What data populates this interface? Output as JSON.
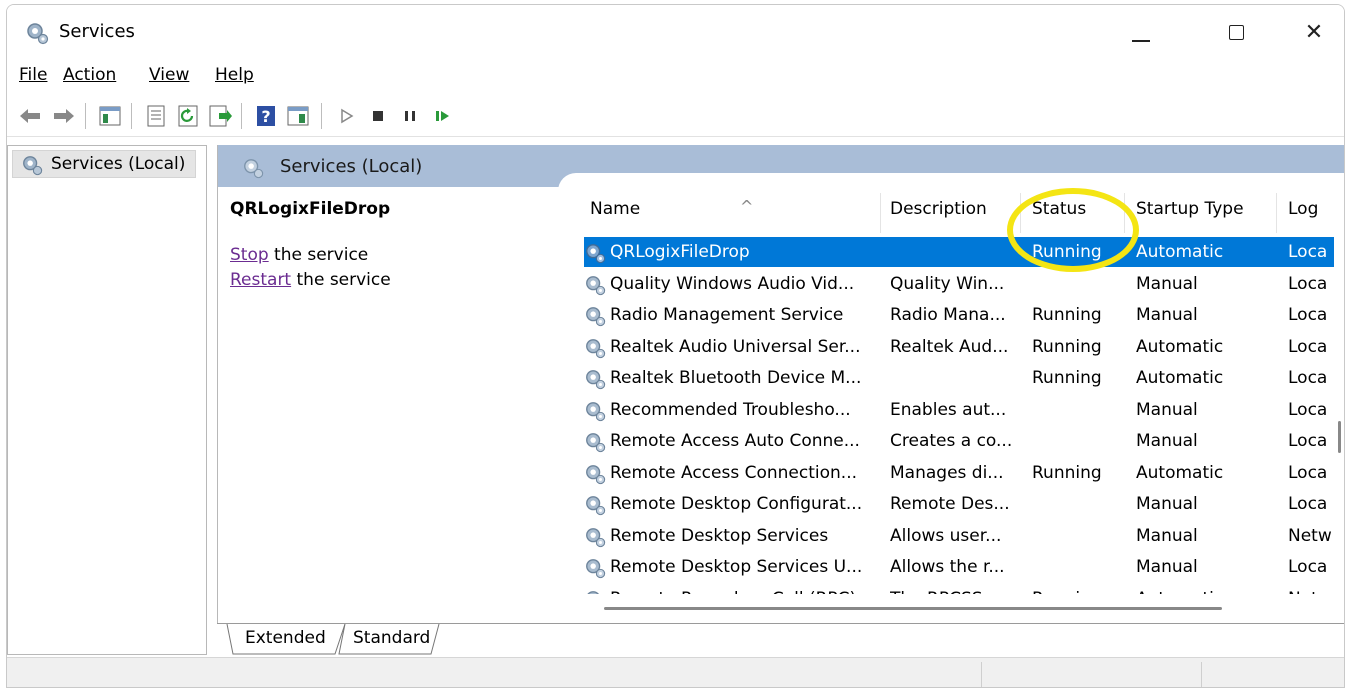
{
  "window": {
    "title": "Services",
    "minimize_glyph": "—",
    "close_glyph": "✕"
  },
  "menu": {
    "file": "File",
    "action": "Action",
    "view": "View",
    "help": "Help"
  },
  "toolbar": {
    "icons": [
      "back-icon",
      "forward-icon",
      "show-hide-tree-icon",
      "properties-icon",
      "refresh-icon",
      "export-list-icon",
      "help-icon",
      "extended-view-icon",
      "start-service-icon",
      "stop-service-icon",
      "pause-service-icon",
      "resume-service-icon"
    ]
  },
  "tree": {
    "root_label": "Services (Local)"
  },
  "right_pane": {
    "header": "Services (Local)",
    "selected_service": "QRLogixFileDrop",
    "stop_link": "Stop",
    "stop_suffix": " the service",
    "restart_link": "Restart",
    "restart_suffix": " the service"
  },
  "columns": {
    "name": "Name",
    "description": "Description",
    "status": "Status",
    "startup": "Startup Type",
    "logon": "Log"
  },
  "rows": [
    {
      "name": "QRLogixFileDrop",
      "description": "",
      "status": "Running",
      "startup": "Automatic",
      "logon": "Loca"
    },
    {
      "name": "Quality Windows Audio Vid...",
      "description": "Quality Win...",
      "status": "",
      "startup": "Manual",
      "logon": "Loca"
    },
    {
      "name": "Radio Management Service",
      "description": "Radio Mana...",
      "status": "Running",
      "startup": "Manual",
      "logon": "Loca"
    },
    {
      "name": "Realtek Audio Universal Ser...",
      "description": "Realtek Aud...",
      "status": "Running",
      "startup": "Automatic",
      "logon": "Loca"
    },
    {
      "name": "Realtek Bluetooth Device M...",
      "description": "",
      "status": "Running",
      "startup": "Automatic",
      "logon": "Loca"
    },
    {
      "name": "Recommended Troublesho...",
      "description": "Enables aut...",
      "status": "",
      "startup": "Manual",
      "logon": "Loca"
    },
    {
      "name": "Remote Access Auto Conne...",
      "description": "Creates a co...",
      "status": "",
      "startup": "Manual",
      "logon": "Loca"
    },
    {
      "name": "Remote Access Connection...",
      "description": "Manages di...",
      "status": "Running",
      "startup": "Automatic",
      "logon": "Loca"
    },
    {
      "name": "Remote Desktop Configurat...",
      "description": "Remote Des...",
      "status": "",
      "startup": "Manual",
      "logon": "Loca"
    },
    {
      "name": "Remote Desktop Services",
      "description": "Allows user...",
      "status": "",
      "startup": "Manual",
      "logon": "Netw"
    },
    {
      "name": "Remote Desktop Services U...",
      "description": "Allows the r...",
      "status": "",
      "startup": "Manual",
      "logon": "Loca"
    },
    {
      "name": "Remote Procedure Call (RPC)",
      "description": "The RPCSS s...",
      "status": "Running",
      "startup": "Automatic",
      "logon": "Netw"
    }
  ],
  "tabs": {
    "extended": "Extended",
    "standard": "Standard"
  },
  "colors": {
    "selection": "#0078d7",
    "header_band": "#a9bdd7",
    "link": "#6b2c91",
    "highlight": "#f4e514"
  }
}
